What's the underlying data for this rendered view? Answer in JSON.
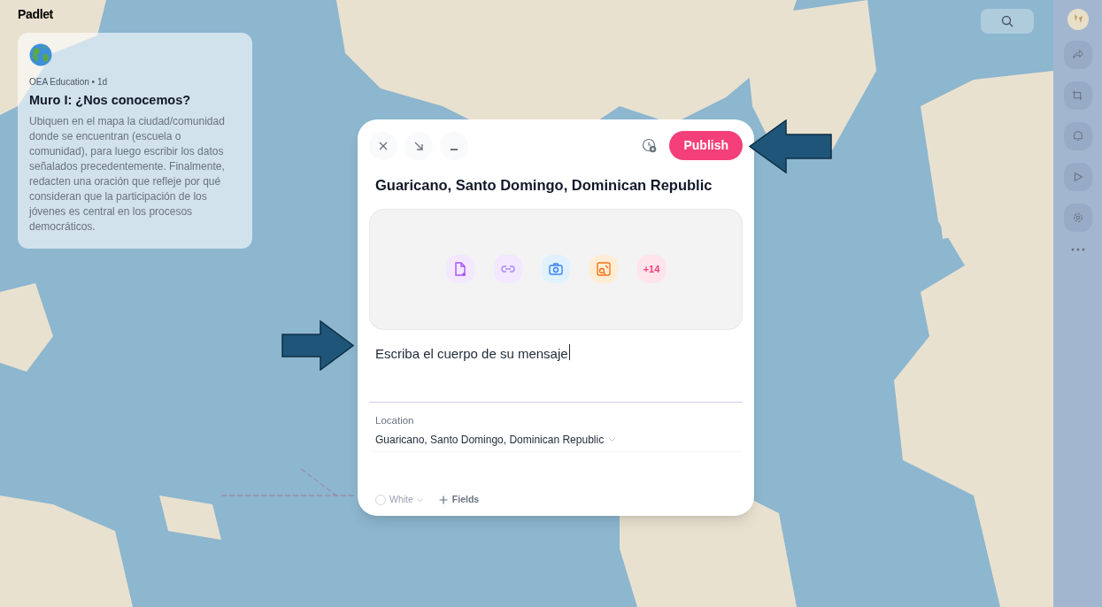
{
  "brand": "Padlet",
  "wall_card": {
    "author": "OEA Education • 1d",
    "title": "Muro I: ¿Nos conocemos?",
    "description": "Ubiquen en el mapa la ciudad/comunidad donde se encuentran (escuela o comunidad), para luego escribir los datos señalados precedentemente. Finalmente, redacten una oración que refleje por qué consideran que la participación de los jóvenes es central en los procesos democráticos."
  },
  "composer": {
    "window_buttons": [
      {
        "kind": "close"
      },
      {
        "kind": "expand"
      },
      {
        "kind": "minimize"
      }
    ],
    "publish": "Publish",
    "title": "Guaricano, Santo Domingo, Dominican Republic",
    "attachments": [
      {
        "kind": "upload"
      },
      {
        "kind": "link"
      },
      {
        "kind": "camera"
      },
      {
        "kind": "image-search"
      },
      {
        "kind": "more",
        "label": "+14"
      }
    ],
    "body": "Escriba el cuerpo de su mensaje",
    "location": {
      "label": "Location",
      "value": "Guaricano, Santo Domingo, Dominican Republic"
    },
    "color_label": "White",
    "fields": "Fields"
  },
  "sidebar": [
    {
      "kind": "share"
    },
    {
      "kind": "remake"
    },
    {
      "kind": "bell"
    },
    {
      "kind": "play"
    },
    {
      "kind": "settings"
    },
    {
      "kind": "more"
    }
  ]
}
